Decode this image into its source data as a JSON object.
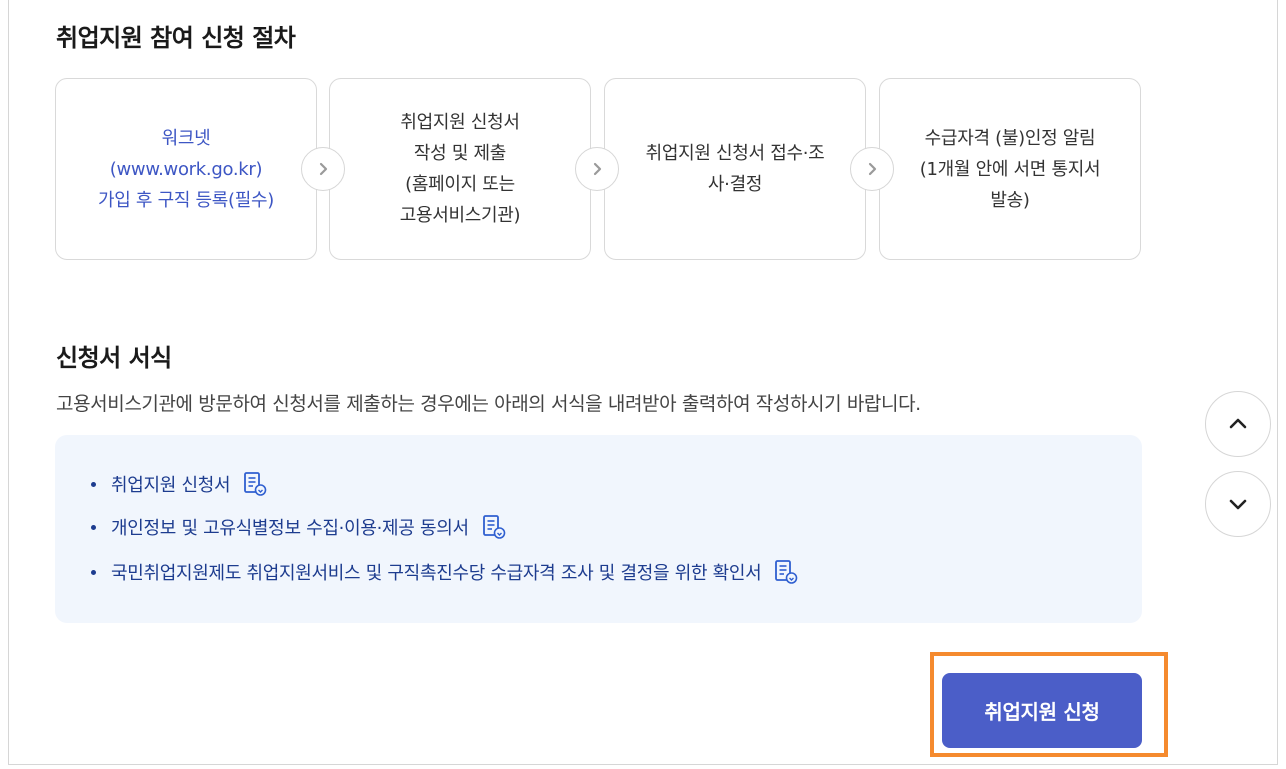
{
  "procedure": {
    "title": "취업지원 참여 신청 절차",
    "steps": [
      {
        "text": "워크넷\n(www.work.go.kr)\n가입 후 구직 등록(필수)"
      },
      {
        "text": "취업지원 신청서\n작성 및 제출\n(홈페이지 또는\n고용서비스기관)"
      },
      {
        "text": "취업지원 신청서 접수·조\n사·결정"
      },
      {
        "text": "수급자격 (불)인정 알림\n(1개월 안에 서면 통지서\n발송)"
      }
    ]
  },
  "forms": {
    "title": "신청서 서식",
    "description": "고용서비스기관에 방문하여 신청서를 제출하는 경우에는 아래의 서식을 내려받아 출력하여 작성하시기 바랍니다.",
    "items": [
      {
        "label": "취업지원 신청서"
      },
      {
        "label": "개인정보 및 고유식별정보 수집·이용·제공 동의서"
      },
      {
        "label": "국민취업지원제도 취업지원서비스 및 구직촉진수당 수급자격 조사 및 결정을 위한 확인서"
      }
    ]
  },
  "actions": {
    "apply_label": "취업지원 신청"
  },
  "colors": {
    "accent": "#4b5ec8",
    "link": "#1d3c8f",
    "highlight": "#f58a2e",
    "box_bg": "#f1f6fd"
  },
  "icons": [
    "chevron-right-icon",
    "document-download-icon",
    "chevron-up-icon",
    "chevron-down-icon"
  ]
}
